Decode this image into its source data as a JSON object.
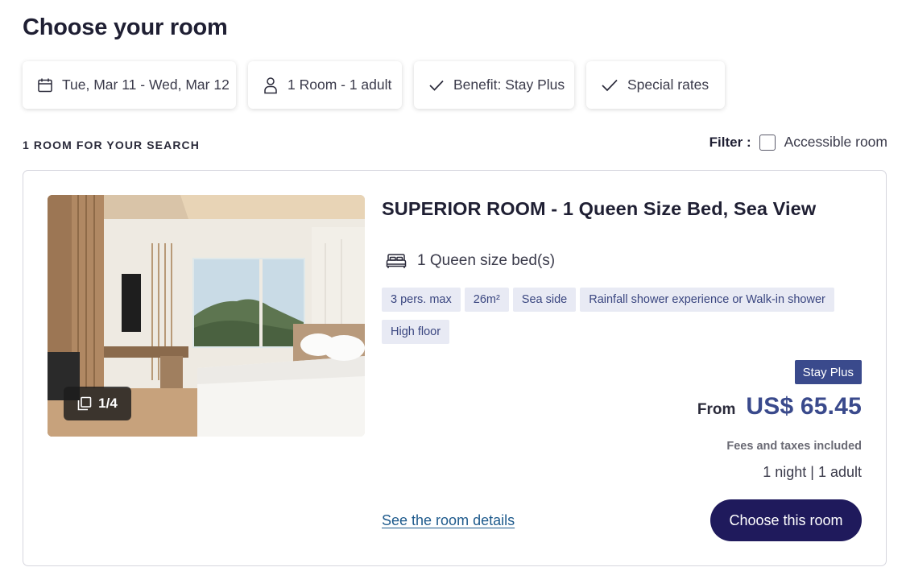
{
  "page": {
    "title": "Choose your room"
  },
  "chips": [
    {
      "label": "Tue, Mar 11 - Wed, Mar 12",
      "icon": "calendar-icon"
    },
    {
      "label": "1 Room - 1 adult",
      "icon": "person-icon"
    },
    {
      "label": "Benefit: Stay Plus",
      "icon": "check-icon"
    },
    {
      "label": "Special rates",
      "icon": "check-icon"
    }
  ],
  "results": {
    "count_label": "1 ROOM FOR YOUR SEARCH",
    "filter_label": "Filter :",
    "filter_option": "Accessible room",
    "filter_checked": false
  },
  "room": {
    "title": "SUPERIOR ROOM - 1 Queen Size Bed, Sea View",
    "photo_counter": "1/4",
    "bed": {
      "label": "1 Queen size bed(s)",
      "icon": "bed-icon"
    },
    "tags": [
      "3 pers. max",
      "26m²",
      "Sea side",
      "Rainfall shower experience or Walk-in shower",
      "High floor"
    ],
    "badge": "Stay Plus",
    "price_prefix": "From",
    "price": "US$ 65.45",
    "fees_note": "Fees and taxes included",
    "stay_summary": "1 night | 1 adult",
    "details_link": "See the room details",
    "cta": "Choose this room"
  },
  "colors": {
    "accent": "#3a4a8c",
    "cta_bg": "#1f1a5c",
    "tag_bg": "#e8eaf4",
    "link": "#1e5a8c"
  }
}
